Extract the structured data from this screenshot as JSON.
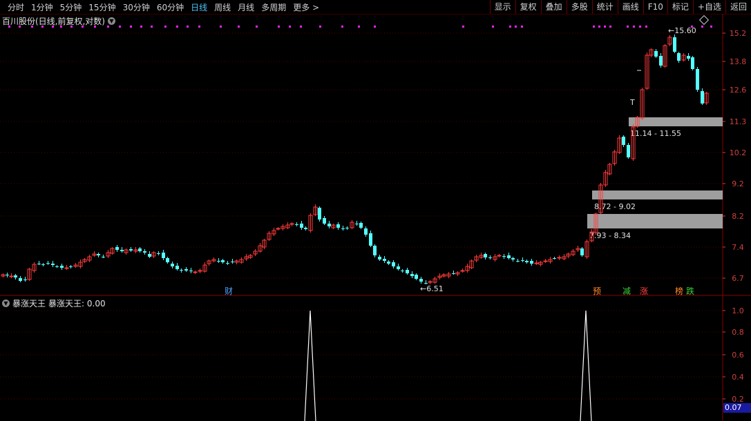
{
  "toolbar": {
    "periods": [
      "分时",
      "1分钟",
      "5分钟",
      "15分钟",
      "30分钟",
      "60分钟",
      "日线",
      "周线",
      "月线",
      "多周期",
      "更多 >"
    ],
    "active_period": "日线",
    "tools": [
      "显示",
      "复权",
      "叠加",
      "多股",
      "统计",
      "画线",
      "F10",
      "标记",
      "+自选",
      "返回"
    ]
  },
  "main_panel": {
    "title": "百川股份(日线,前复权,对数)",
    "price_axis": [
      "15.2",
      "13.8",
      "12.6",
      "11.3",
      "10.2",
      "9.2",
      "8.2",
      "7.4",
      "6.7"
    ],
    "high_label": "15.60",
    "low_label": "6.51",
    "zones": [
      {
        "label": "11.14 - 11.55",
        "low": 11.14,
        "high": 11.55
      },
      {
        "label": "8.72 - 9.02",
        "low": 8.72,
        "high": 9.02
      },
      {
        "label": "7.93 - 8.34",
        "low": 7.93,
        "high": 8.34
      }
    ],
    "markers": [
      {
        "text": "财",
        "color": "#4aa3ff"
      },
      {
        "text": "预",
        "color": "#ff8a2a"
      },
      {
        "text": "减",
        "color": "#3ad03a"
      },
      {
        "text": "涨",
        "color": "#ff4040"
      },
      {
        "text": "榜",
        "color": "#ff8a2a"
      },
      {
        "text": "跌",
        "color": "#3ad03a"
      }
    ],
    "t_label": "T",
    "colors": {
      "up": "#ff3b3b",
      "down": "#54ffff",
      "grid": "#5a0000",
      "axis": "#d04040",
      "dots": "#ff22ff"
    }
  },
  "indicator_panel": {
    "title": "暴涨天王",
    "value_label": "暴涨天王: 0.00",
    "axis": [
      "1.0",
      "0.8",
      "0.6",
      "0.4",
      "0.2"
    ],
    "last_value": "0.07"
  }
}
